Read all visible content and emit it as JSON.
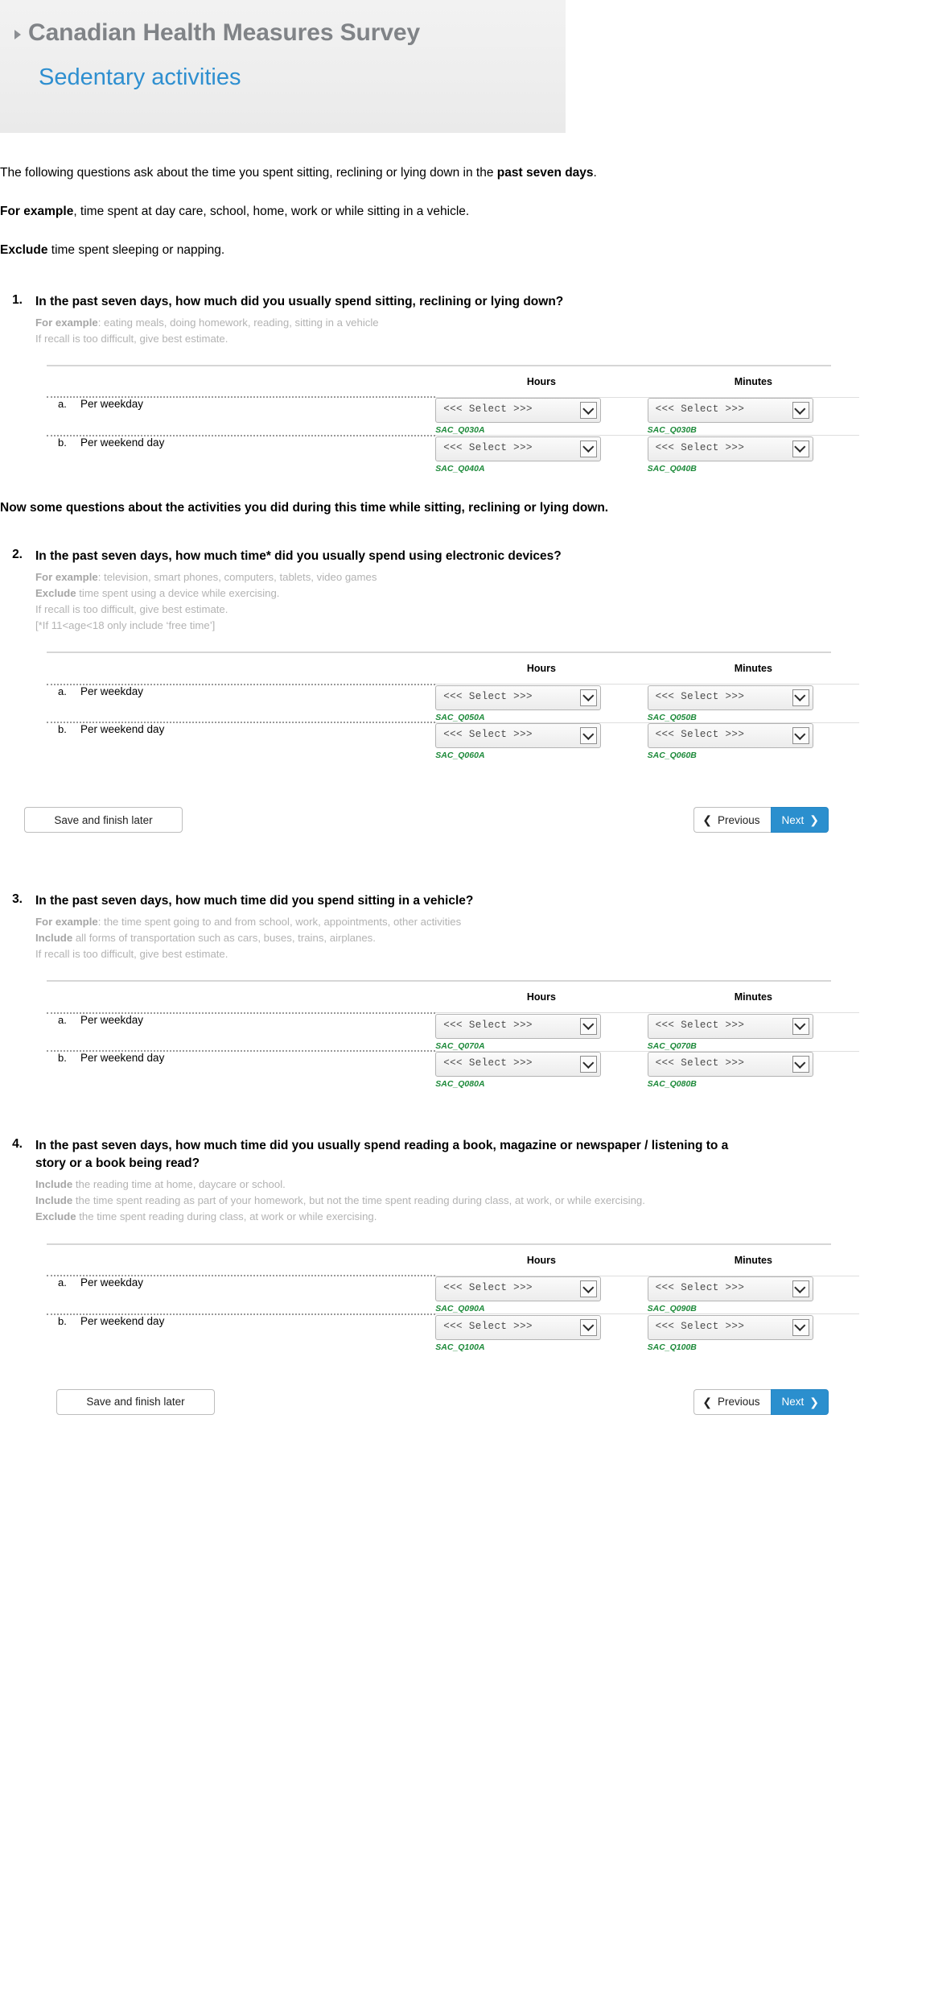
{
  "header": {
    "survey_title": "Canadian Health Measures Survey",
    "page_title": "Sedentary activities",
    "expand_icon": "triangle-right-icon",
    "title_color": "#808387",
    "page_title_color": "#2e8fd0"
  },
  "intro": {
    "p1_a": "The following questions ask about the time you spent sitting, reclining or lying down in the ",
    "p1_b": "past seven days",
    "p1_c": ".",
    "p2_b": "For example",
    "p2_a": ", time spent at day care, school, home, work or while sitting in a vehicle.",
    "p3_b": "Exclude",
    "p3_a": " time spent sleeping or napping."
  },
  "statement": "Now some questions about the activities you did during this time while sitting, reclining or lying down.",
  "grid_headers": {
    "hours": "Hours",
    "minutes": "Minutes"
  },
  "rows": {
    "a_letter": "a.",
    "a_label": "Per weekday",
    "b_letter": "b.",
    "b_label": "Per weekend day"
  },
  "select": {
    "placeholder": "<<< Select >>>",
    "arrow_icon": "chevron-down-icon"
  },
  "questions": [
    {
      "number": "1.",
      "text_pre": "In the ",
      "text_bold": "past seven days",
      "text_post": ", how much did you usually spend sitting, reclining or lying down?",
      "notes": [
        {
          "bold": "For example",
          "rest": ": eating meals, doing homework, reading, sitting in a vehicle"
        },
        {
          "bold": "",
          "rest": "If recall is too difficult, give best estimate."
        }
      ],
      "codes": {
        "a_hours": "SAC_Q030A",
        "a_minutes": "SAC_Q030B",
        "b_hours": "SAC_Q040A",
        "b_minutes": "SAC_Q040B"
      }
    },
    {
      "number": "2.",
      "text_pre": "In the ",
      "text_bold": "past seven days",
      "text_post": ", how much time* did you usually spend using electronic devices?",
      "notes": [
        {
          "bold": "For example",
          "rest": ": television, smart phones, computers, tablets, video games"
        },
        {
          "bold": "Exclude",
          "rest": " time spent using a device while exercising."
        },
        {
          "bold": "",
          "rest": "If recall is too difficult, give best estimate."
        },
        {
          "bold": "",
          "rest": "[*If 11<age<18 only include ‘free time’]"
        }
      ],
      "codes": {
        "a_hours": "SAC_Q050A",
        "a_minutes": "SAC_Q050B",
        "b_hours": "SAC_Q060A",
        "b_minutes": "SAC_Q060B"
      }
    },
    {
      "number": "3.",
      "text_pre": "In the ",
      "text_bold": "past seven days",
      "text_post": ", how much time did you spend sitting in a vehicle?",
      "notes": [
        {
          "bold": "For example",
          "rest": ": the time spent going to and from school, work, appointments, other activities"
        },
        {
          "bold": "Include",
          "rest": " all forms of transportation such as cars, buses, trains, airplanes."
        },
        {
          "bold": "",
          "rest": "If recall is too difficult, give best estimate."
        }
      ],
      "codes": {
        "a_hours": "SAC_Q070A",
        "a_minutes": "SAC_Q070B",
        "b_hours": "SAC_Q080A",
        "b_minutes": "SAC_Q080B"
      }
    },
    {
      "number": "4.",
      "text_pre": "In the past seven days, how much time did you usually spend reading a book, magazine or newspaper / listening to a story or a book being read?",
      "text_bold": "",
      "text_post": "",
      "notes": [
        {
          "bold": "Include",
          "rest": " the reading time at home, daycare or school."
        },
        {
          "bold": "Include",
          "rest": " the time spent reading as part of your homework, but not the time spent reading during class, at work, or while exercising."
        },
        {
          "bold": "Exclude",
          "rest": " the time spent reading during class, at work or while exercising."
        }
      ],
      "codes": {
        "a_hours": "SAC_Q090A",
        "a_minutes": "SAC_Q090B",
        "b_hours": "SAC_Q100A",
        "b_minutes": "SAC_Q100B"
      }
    }
  ],
  "nav": {
    "save_label": "Save and finish later",
    "previous_label": "Previous",
    "next_label": "Next",
    "prev_icon": "chevron-left-icon",
    "next_icon": "chevron-right-icon",
    "next_color": "#2b8fce"
  }
}
